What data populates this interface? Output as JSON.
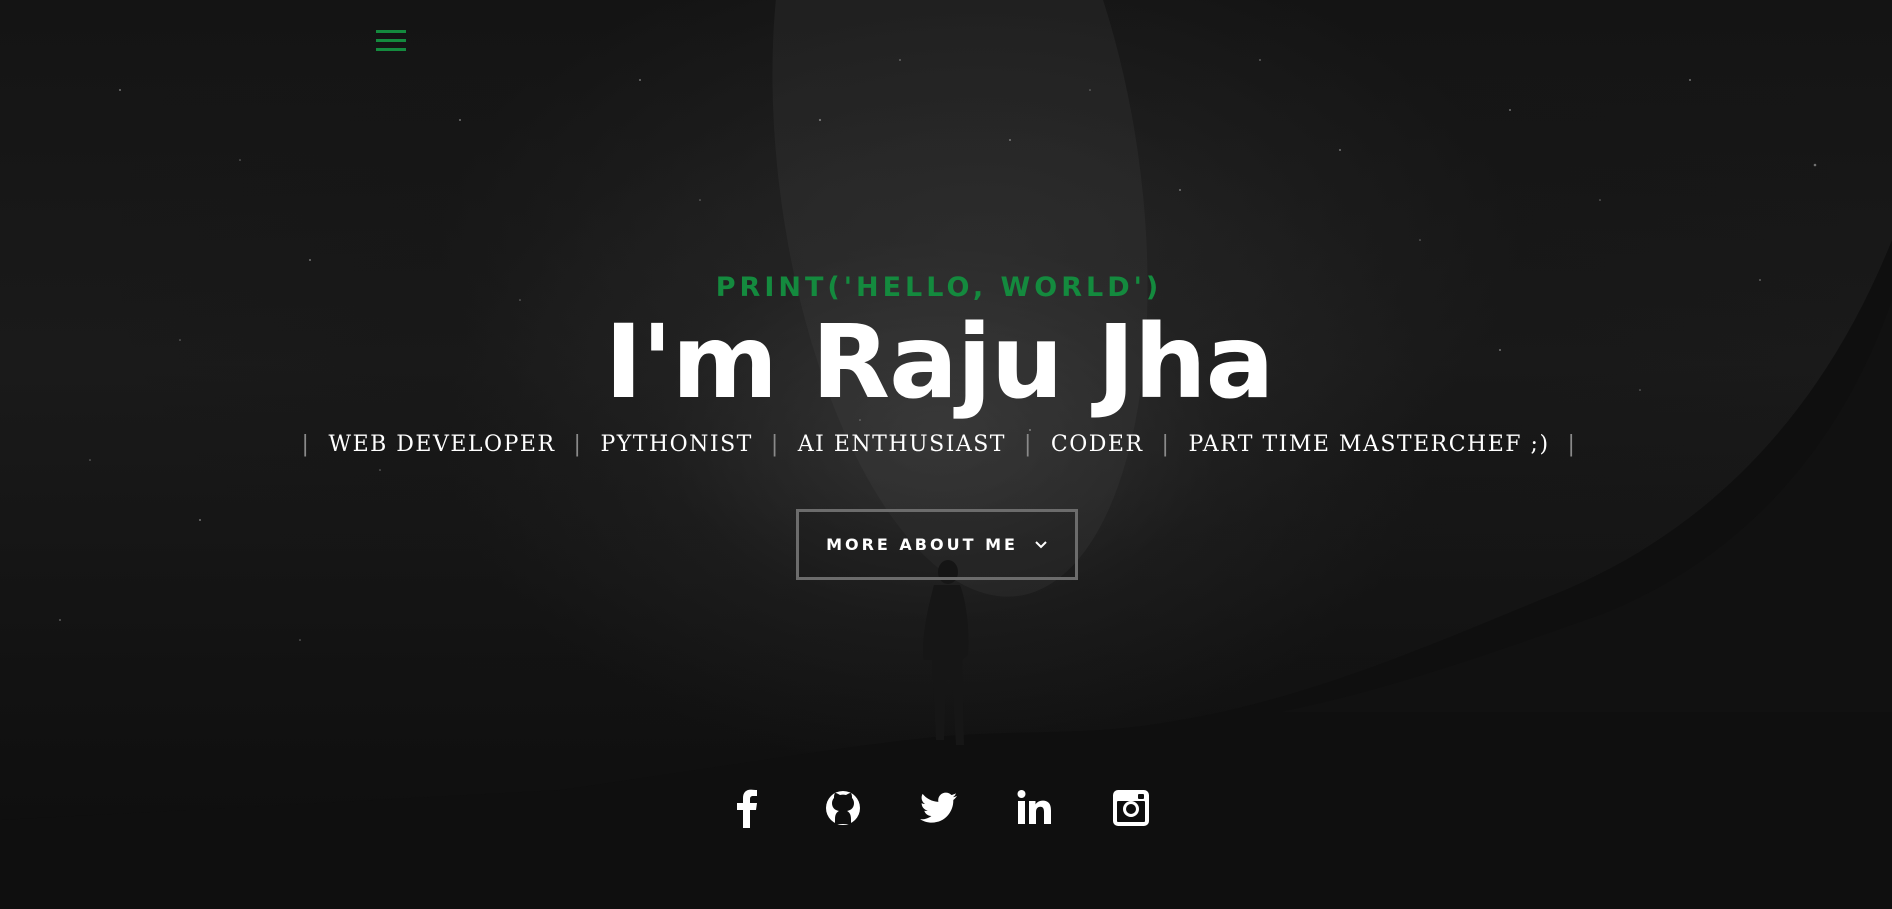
{
  "hero": {
    "pretitle": "print('hello, world')",
    "title": "I'm Raju Jha",
    "roles": [
      "WEB DEVELOPER",
      "PYTHONIST",
      "AI ENTHUSIAST",
      "CODER",
      "PART TIME MASTERCHEF ;)"
    ],
    "separator": "|",
    "cta_label": "MORE ABOUT ME"
  },
  "nav": {
    "menu_icon": "hamburger-menu-icon"
  },
  "social": [
    {
      "icon": "facebook-icon"
    },
    {
      "icon": "github-icon"
    },
    {
      "icon": "twitter-icon"
    },
    {
      "icon": "linkedin-icon"
    },
    {
      "icon": "instagram-icon"
    }
  ],
  "colors": {
    "accent": "#148a3e",
    "background": "#0e0e0e",
    "text": "#ffffff",
    "button_border": "#6c6c6c"
  }
}
